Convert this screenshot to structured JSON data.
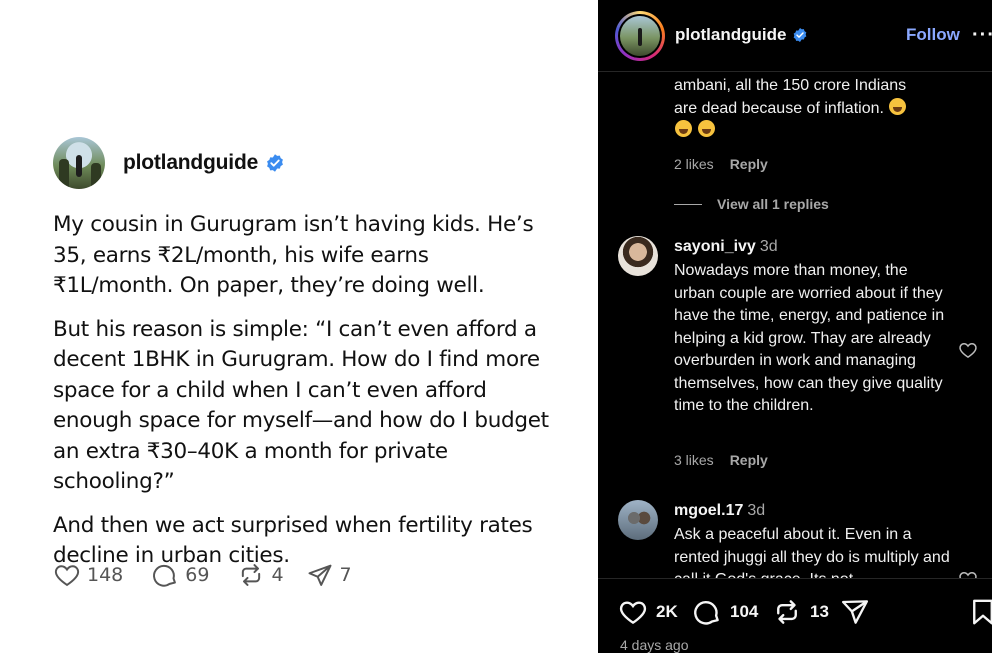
{
  "post": {
    "username": "plotlandguide",
    "paragraphs": [
      "My cousin in Gurugram isn’t having kids. He’s 35, earns ₹2L/month, his wife earns ₹1L/month. On paper, they’re doing well.",
      "But his reason is simple: “I can’t even afford a decent 1BHK in Gurugram. How do I find more space for a child when I can’t even afford enough space for myself—and how do I budget an extra ₹30–40K a month for private schooling?”",
      "And then we act surprised when fertility rates decline in urban cities."
    ],
    "likes": "148",
    "replies": "69",
    "reposts": "4",
    "shares": "7"
  },
  "panel": {
    "username": "plotlandguide",
    "follow_label": "Follow",
    "more_label": "···",
    "accent_color": "#8aa8ff",
    "comments": [
      {
        "text_lines": [
          "ambani, all the 150 crore Indians",
          "are dead because of inflation."
        ],
        "likes": "2 likes",
        "reply_label": "Reply",
        "view_replies": "View all 1 replies"
      },
      {
        "user": "sayoni_ivy",
        "time": "3d",
        "text": "Nowadays more than money, the urban couple are worried about if they have the time, energy, and patience in helping a kid grow. Thay are already overburden in work and managing themselves, how can they give quality time to the children.",
        "likes": "3 likes",
        "reply_label": "Reply"
      },
      {
        "user": "mgoel.17",
        "time": "3d",
        "text": "Ask a peaceful about it. Even in a rented jhuggi all they do is multiply and call it God's grace. Its not"
      }
    ],
    "actions": {
      "likes": "2K",
      "comments": "104",
      "reposts": "13"
    },
    "date": "4 days ago"
  }
}
